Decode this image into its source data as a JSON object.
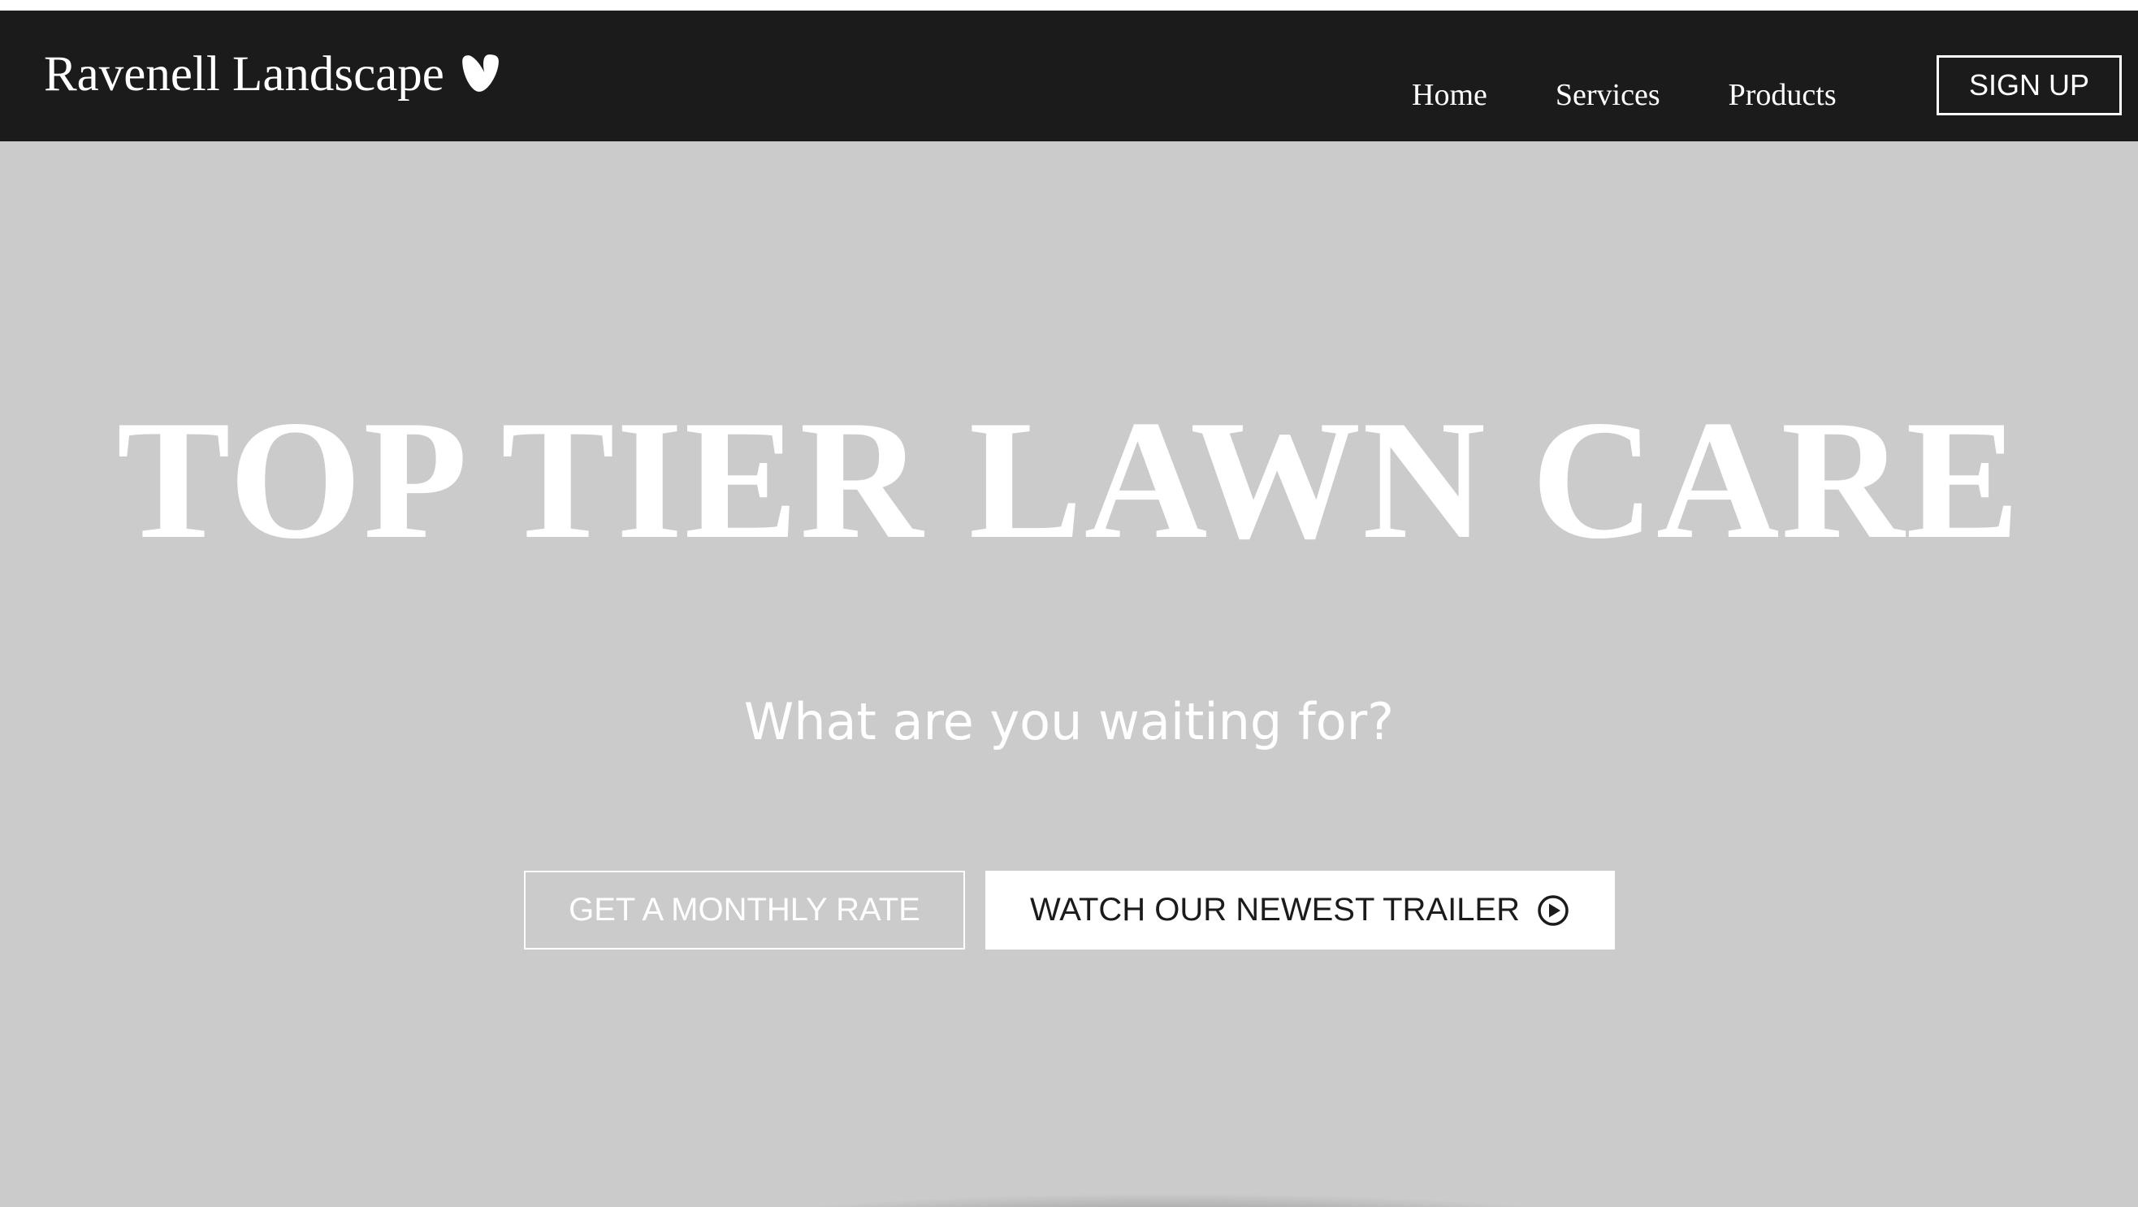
{
  "header": {
    "brand_name": "Ravenell Landscape",
    "brand_icon": "typo3-logo-icon",
    "nav": [
      {
        "label": "Home"
      },
      {
        "label": "Services"
      },
      {
        "label": "Products"
      }
    ],
    "signup_label": "SIGN UP"
  },
  "hero": {
    "title": "TOP TIER LAWN CARE",
    "subtitle": "What are you waiting for?",
    "primary_cta_label": "GET A MONTHLY RATE",
    "secondary_cta_label": "WATCH OUR NEWEST TRAILER",
    "secondary_cta_icon": "play-circle-icon"
  },
  "colors": {
    "navbar_bg": "#1c1b1c",
    "hero_bg": "#cbcbcb",
    "text_light": "#ffffff",
    "text_dark": "#1c1b1c"
  }
}
